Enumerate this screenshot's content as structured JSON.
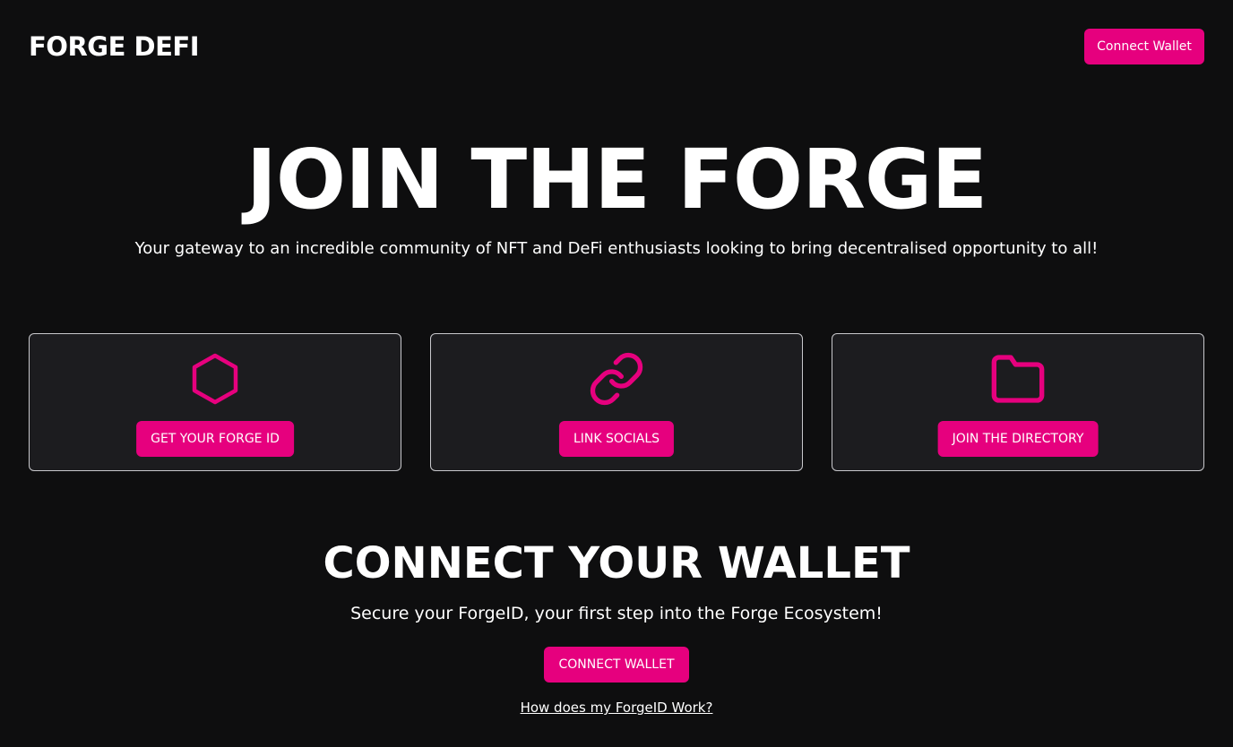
{
  "header": {
    "logo": "FORGE DEFI",
    "connect_label": "Connect Wallet"
  },
  "hero": {
    "title": "JOIN THE FORGE",
    "subtitle": "Your gateway to an incredible community of NFT and DeFi enthusiasts looking to bring decentralised opportunity to all!"
  },
  "cards": [
    {
      "icon": "hexagon-icon",
      "button_label": "GET YOUR FORGE ID"
    },
    {
      "icon": "link-icon",
      "button_label": "LINK SOCIALS"
    },
    {
      "icon": "folder-icon",
      "button_label": "JOIN THE DIRECTORY"
    }
  ],
  "wallet_section": {
    "title": "CONNECT YOUR WALLET",
    "subtitle": "Secure your ForgeID, your first step into the Forge Ecosystem!",
    "button_label": "CONNECT WALLET",
    "help_link": "How does my ForgeID Work?"
  },
  "colors": {
    "background": "#0e0e0f",
    "accent": "#e6007e",
    "card_background": "#1c1c1f",
    "card_border": "#c8c8cc",
    "text": "#ffffff"
  }
}
